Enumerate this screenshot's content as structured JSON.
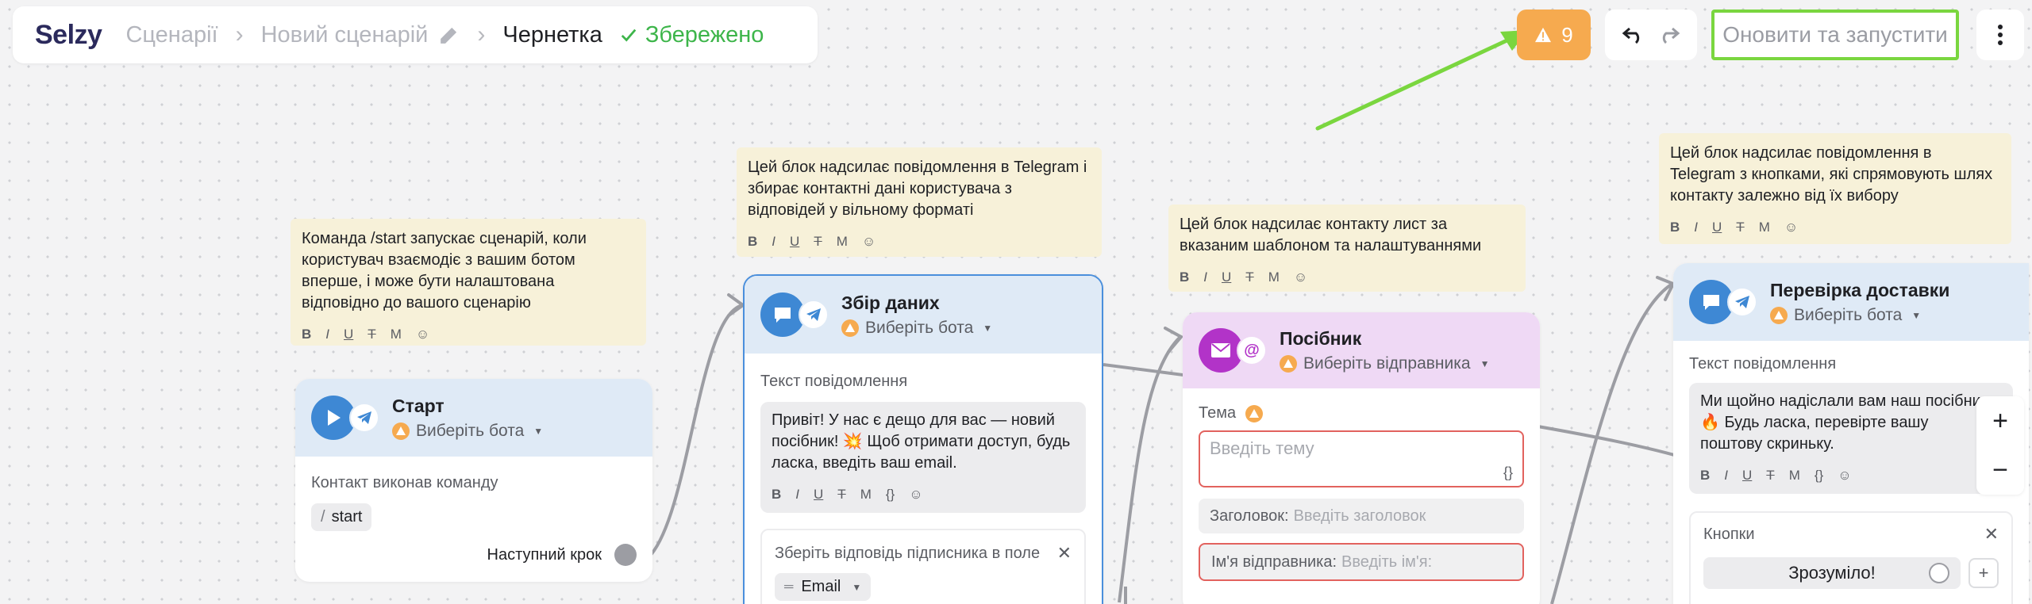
{
  "header": {
    "logo": "Selzy",
    "breadcrumb": [
      "Сценарії",
      "Новий сценарій"
    ],
    "status_draft": "Чернетка",
    "status_saved": "Збережено"
  },
  "toolbar": {
    "warnings_count": "9",
    "run_label": "Оновити та запустити"
  },
  "notes": {
    "start": "Команда /start запускає сценарій, коли користувач взаємодіє з вашим ботом вперше, і може бути налаштована відповідно до вашого сценарію",
    "collect": "Цей блок надсилає повідомлення в Telegram і збирає контактні дані користувача з відповідей у вільному форматі",
    "email": "Цей блок надсилає контакту лист за вказаним шаблоном та налаштуваннями",
    "check": "Цей блок надсилає повідомлення в Telegram з кнопками, які спрямовують шлях контакту залежно від їх вибору"
  },
  "note_tools": [
    "B",
    "I",
    "U",
    "T",
    "M",
    "☺"
  ],
  "note_tools_ext": [
    "B",
    "I",
    "U",
    "T",
    "M",
    "{}",
    "☺"
  ],
  "start_card": {
    "title": "Старт",
    "bot_select": "Виберіть бота",
    "trigger_label": "Контакт виконав команду",
    "command_slash": "/",
    "command": "start",
    "next_step": "Наступний крок"
  },
  "collect_card": {
    "title": "Збір даних",
    "bot_select": "Виберіть бота",
    "msg_label": "Текст повідомлення",
    "msg_text": "Привіт! У нас є дещо для вас — новий посібник! 💥 Щоб отримати доступ, будь ласка, введіть ваш email.",
    "save_label": "Зберіть відповідь підписника в поле",
    "save_field": "Email"
  },
  "email_card": {
    "title": "Посібник",
    "sender_select": "Виберіть відправника",
    "subject_label": "Тема",
    "subject_placeholder": "Введіть тему",
    "heading_label": "Заголовок:",
    "heading_placeholder": "Введіть заголовок",
    "sender_name_label": "Ім'я відправника:",
    "sender_name_placeholder": "Введіть ім'я:"
  },
  "check_card": {
    "title": "Перевірка доставки",
    "bot_select": "Виберіть бота",
    "msg_label": "Текст повідомлення",
    "msg_text": "Ми щойно надіслали вам наш посібник 🔥 Будь ласка, перевірте вашу поштову скриньку.",
    "buttons_label": "Кнопки",
    "button_1": "Зрозуміло!"
  },
  "zoom": {
    "plus": "+",
    "minus": "−"
  },
  "colors": {
    "accent_green": "#7ad63f",
    "warning_orange": "#f6aa4f",
    "telegram_blue": "#3e88d4",
    "email_purple": "#b233c8",
    "error_red": "#e2625e"
  }
}
